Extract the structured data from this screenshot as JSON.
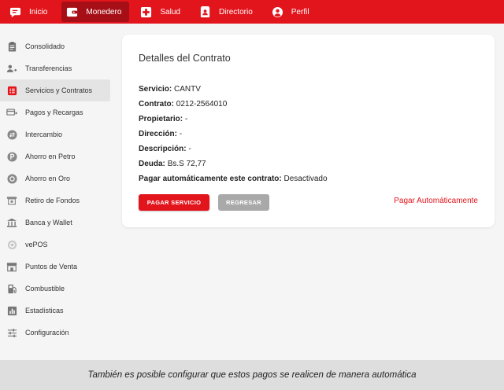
{
  "colors": {
    "brand": "#e2141c",
    "brand_dark": "#a60f16",
    "sidebar_active": "#e4e4e4",
    "button_disabled": "#a9a9a9"
  },
  "topnav": [
    {
      "label": "Inicio",
      "icon": "chat-icon",
      "active": false
    },
    {
      "label": "Monedero",
      "icon": "wallet-icon",
      "active": true
    },
    {
      "label": "Salud",
      "icon": "health-cross-icon",
      "active": false
    },
    {
      "label": "Directorio",
      "icon": "contacts-book-icon",
      "active": false
    },
    {
      "label": "Perfil",
      "icon": "user-icon",
      "active": false
    }
  ],
  "sidebar": [
    {
      "label": "Consolidado",
      "icon": "clipboard-icon"
    },
    {
      "label": "Transferencias",
      "icon": "person-transfer-icon"
    },
    {
      "label": "Servicios y Contratos",
      "icon": "receipt-icon",
      "active": true
    },
    {
      "label": "Pagos y Recargas",
      "icon": "payment-card-icon"
    },
    {
      "label": "Intercambio",
      "icon": "exchange-icon"
    },
    {
      "label": "Ahorro en Petro",
      "icon": "petro-coin-icon"
    },
    {
      "label": "Ahorro en Oro",
      "icon": "gold-coin-icon"
    },
    {
      "label": "Retiro de Fondos",
      "icon": "withdraw-icon"
    },
    {
      "label": "Banca y Wallet",
      "icon": "bank-icon"
    },
    {
      "label": "vePOS",
      "icon": "pos-icon"
    },
    {
      "label": "Puntos de Venta",
      "icon": "store-icon"
    },
    {
      "label": "Combustible",
      "icon": "fuel-pump-icon"
    },
    {
      "label": "Estadísticas",
      "icon": "bar-chart-icon"
    },
    {
      "label": "Configuración",
      "icon": "sliders-icon"
    }
  ],
  "card": {
    "title": "Detalles del Contrato",
    "details": [
      {
        "label": "Servicio:",
        "value": "CANTV"
      },
      {
        "label": "Contrato:",
        "value": "0212-2564010"
      },
      {
        "label": "Propietario:",
        "value": "-"
      },
      {
        "label": "Dirección:",
        "value": "-"
      },
      {
        "label": "Descripción:",
        "value": "-"
      },
      {
        "label": "Deuda:",
        "value": "Bs.S 72,77"
      },
      {
        "label": "Pagar automáticamente este contrato:",
        "value": "Desactivado"
      }
    ],
    "pay_button": "PAGAR SERVICIO",
    "back_button": "REGRESAR",
    "auto_link": "Pagar Automáticamente"
  },
  "caption": "También es posible configurar que estos pagos se realicen de manera automática"
}
